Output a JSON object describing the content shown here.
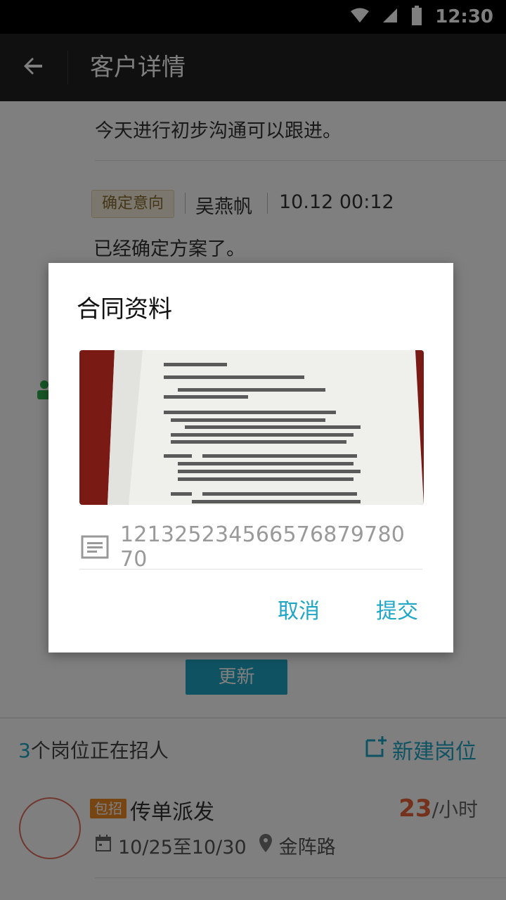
{
  "status_bar": {
    "time": "12:30"
  },
  "app_bar": {
    "title": "客户详情"
  },
  "background": {
    "note_1": "今天进行初步沟通可以跟进。",
    "record": {
      "tag": "确定意向",
      "name": "吴燕帆",
      "datetime": "10.12 00:12",
      "text": "已经确定方案了。"
    },
    "update_button": "更新",
    "jobs": {
      "count": "3",
      "count_suffix": "个岗位正在招人",
      "new_job_label": "新建岗位",
      "item": {
        "tag": "包招",
        "title": "传单派发",
        "salary_amount": "23",
        "salary_unit": "/小时",
        "date_range": "10/25至10/30",
        "location": "金阵路"
      }
    }
  },
  "dialog": {
    "title": "合同资料",
    "image_alt": "contract photo",
    "contract_number": "121325234566576879780 70",
    "cancel_label": "取消",
    "submit_label": "提交"
  },
  "colors": {
    "accent": "#1fa6c6",
    "orange": "#ef8a25",
    "salary": "#e9643a",
    "overlay": "rgba(0,0,0,0.5)"
  }
}
